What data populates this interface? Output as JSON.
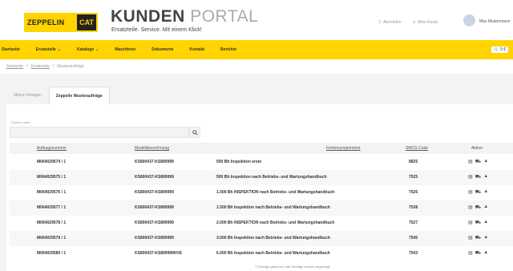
{
  "header": {
    "logo_text": "ZEPPELIN",
    "cat_text": "CAT",
    "title_a": "KUNDEN",
    "title_b": "PORTAL",
    "subtitle": "Ersatzteile. Service. Mit einem Klick!",
    "link_abmelden": "Abmelden",
    "link_konto": "Mein Konto",
    "user_name": "Max Mustermann"
  },
  "nav": {
    "items": [
      "Startseite",
      "Ersatzteile",
      "Kataloge",
      "Maschinen",
      "Dokumente",
      "Kontakt",
      "Berichte"
    ],
    "cart": "0 €"
  },
  "breadcrumb": {
    "a": "Startseite",
    "sep1": "/",
    "b": "Ersatzteile",
    "sep2": "/",
    "c": "Musteraufträge"
  },
  "tabs": {
    "t1": "Meine Vorlagen",
    "t2": "Zeppelin Musteraufträge"
  },
  "search": {
    "label": "Suchen nach",
    "placeholder": ""
  },
  "table": {
    "headers": {
      "auftrag": "Auftragsnummer",
      "modell": "Modellbezeichnung",
      "text": "Fehlersymptomtext",
      "smcs": "SMCS-Code",
      "aktion": "Aktion"
    },
    "rows": [
      {
        "auftrag": "M064029574 / 1",
        "modell": "KS800437-KS899999",
        "text": "500 Bh Inspektion erste",
        "smcs": "8825"
      },
      {
        "auftrag": "M064029575 / 1",
        "modell": "KS800437-KS899999",
        "text": "500 Bh Inspektion nach Betriebs- und Wartungshandbuch",
        "smcs": "7525"
      },
      {
        "auftrag": "M064029576 / 1",
        "modell": "KS800437-KS899999",
        "text": "1.000 Bh INSPEKTION nach Betriebs- und Wartungshandbuch",
        "smcs": "7526"
      },
      {
        "auftrag": "M064029577 / 1",
        "modell": "KS800437-KS899999",
        "text": "1.500 Bh Inspektion nach Betriebs- und Wartungshandbuch",
        "smcs": "7538"
      },
      {
        "auftrag": "M064029578 / 1",
        "modell": "KS800437-KS899999",
        "text": "2.000 Bh INSPEKTION nach Betriebs- und Wartungshandbuch",
        "smcs": "7527"
      },
      {
        "auftrag": "M064029579 / 1",
        "modell": "KS800437-KS899999",
        "text": "3.000 Bh Inspektion nach Betriebs- und Wartungshandbuch",
        "smcs": "7545"
      },
      {
        "auftrag": "M064029580 / 1",
        "modell": "KS800437-KS899999HVE",
        "text": "6.000 Bh Inspektion nach Betriebs- und Wartungshandbuch",
        "smcs": "7543"
      }
    ],
    "footer": "7 Einträge gefunden, alle Einträge werden angezeigt."
  },
  "colors": {
    "brand_yellow": "#ffd400",
    "bg_grey": "#f3f3f3"
  }
}
